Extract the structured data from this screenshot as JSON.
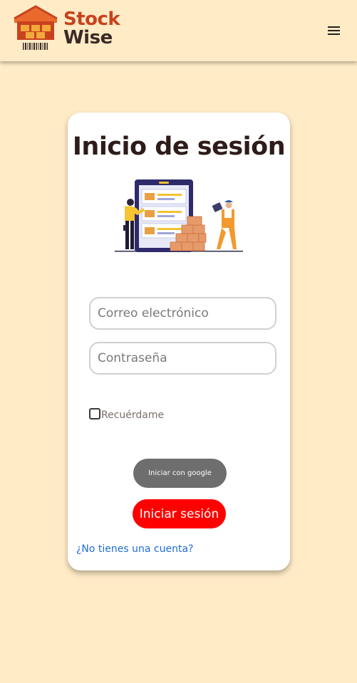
{
  "brand": {
    "line1": "Stock",
    "line2": "Wise",
    "primary_color": "#C8421E",
    "secondary_color": "#3A2A26"
  },
  "header": {
    "menu_icon": "hamburger-menu-icon"
  },
  "login": {
    "title": "Inicio de sesión",
    "email_placeholder": "Correo electrónico",
    "email_value": "",
    "password_placeholder": "Contraseña",
    "password_value": "",
    "remember_label": "Recuérdame",
    "remember_checked": false,
    "google_button_label": "Iniciar con google",
    "login_button_label": "Iniciar sesión",
    "signup_link_label": "¿No tienes una cuenta?"
  },
  "colors": {
    "page_background": "#FFEBC6",
    "card_background": "#FFFFFF",
    "google_button": "#6E6E6E",
    "login_button": "#FF0000",
    "link": "#1F6BD9"
  }
}
